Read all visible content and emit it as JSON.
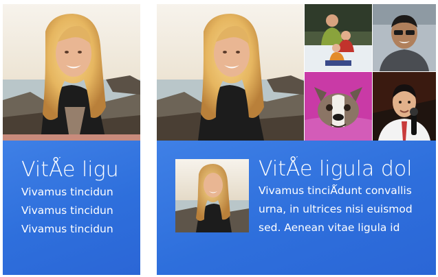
{
  "tiles": {
    "small": {
      "title": "VitǺe ligu",
      "lines": [
        "Vivamus tincidun",
        "Vivamus tincidun",
        "Vivamus tincidun"
      ]
    },
    "wide": {
      "title": "VitǺe ligula dol",
      "lines": [
        "Vivamus tinciǺdunt convallis",
        "urna, in ultrices nisi euismod",
        "sed. Aenean vitae ligula id"
      ]
    }
  },
  "colors": {
    "tile_blue": "#2e6fdc",
    "text": "#ffffff"
  },
  "photos": {
    "main": "woman-portrait-photo",
    "family": "family-snow-photo",
    "man_glasses": "man-glasses-photo",
    "dog": "bulldog-photo",
    "man_microphone": "man-microphone-photo"
  }
}
